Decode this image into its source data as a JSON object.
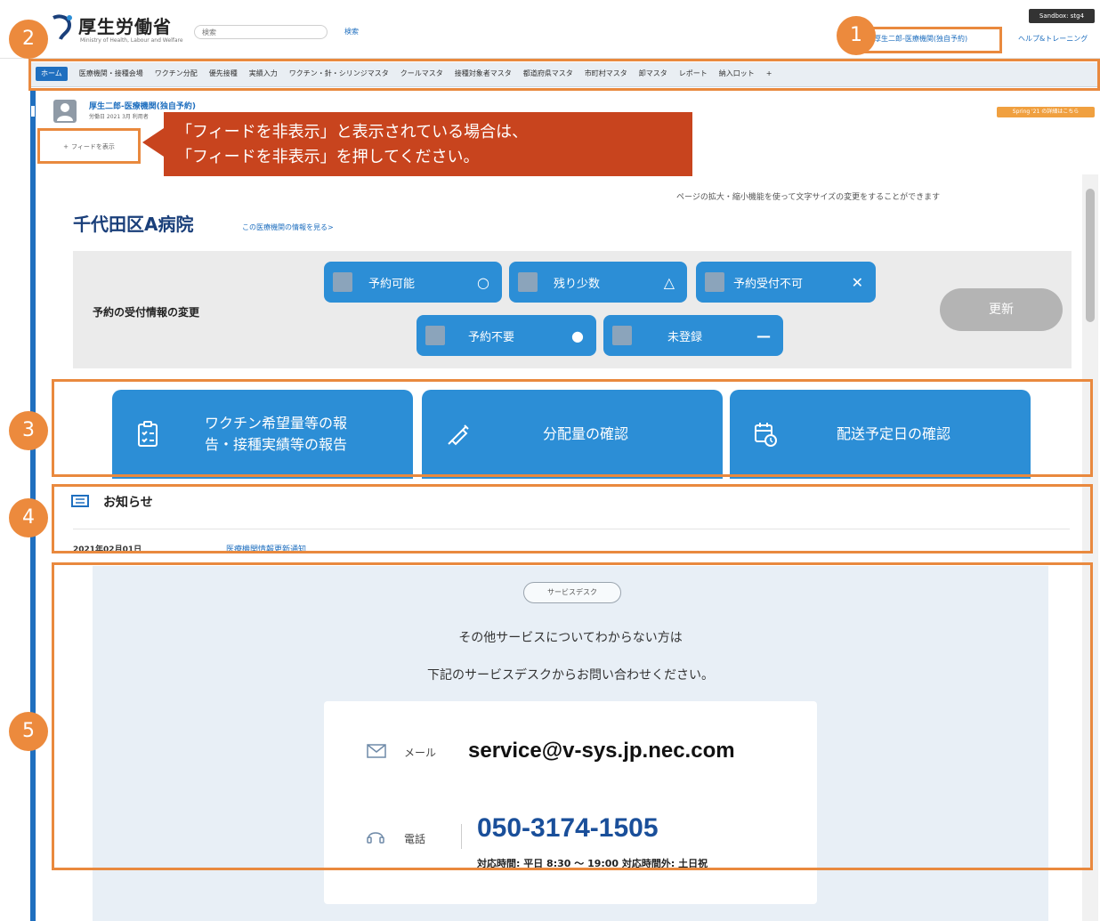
{
  "header": {
    "logo_title": "厚生労働省",
    "logo_sub": "Ministry of Health, Labour and Welfare",
    "search_placeholder": "検索",
    "search_button": "検索",
    "user_link": "厚生二郎-医療機関(独自予約)",
    "help_link": "ヘルプ&トレーニング",
    "sandbox_badge": "Sandbox: stg4"
  },
  "nav": {
    "items": [
      {
        "label": "ホーム",
        "active": true
      },
      {
        "label": "医療機関・接種会場"
      },
      {
        "label": "ワクチン分配"
      },
      {
        "label": "優先接種"
      },
      {
        "label": "実績入力"
      },
      {
        "label": "ワクチン・針・シリンジマスタ"
      },
      {
        "label": "クールマスタ"
      },
      {
        "label": "接種対象者マスタ"
      },
      {
        "label": "都道府県マスタ"
      },
      {
        "label": "市町村マスタ"
      },
      {
        "label": "卸マスタ"
      },
      {
        "label": "レポート"
      },
      {
        "label": "納入口ット"
      },
      {
        "label": "+"
      }
    ]
  },
  "record": {
    "title": "厚生二郎-医療機関(独自予約)",
    "subtitle": "労働日 2021 3月 利用者",
    "orange_pill": "Spring '21 の詳細はこちら",
    "feed_button": "フィードを表示"
  },
  "callout": {
    "line1": "「フィードを非表示」と表示されている場合は、",
    "line2": "「フィードを非表示」を押してください。"
  },
  "main": {
    "zoom_note": "ページの拡大・縮小機能を使って文字サイズの変更をすることができます",
    "hospital_name": "千代田区A病院",
    "hospital_link": "この医療機関の情報を見る>",
    "status_label": "予約の受付情報の変更",
    "status_buttons": [
      {
        "label": "予約可能",
        "symbol": "○"
      },
      {
        "label": "残り少数",
        "symbol": "△"
      },
      {
        "label": "予約受付不可",
        "symbol": "✕"
      },
      {
        "label": "予約不要",
        "symbol": "●"
      },
      {
        "label": "未登録",
        "symbol": "—"
      }
    ],
    "update_button": "更新",
    "actions": [
      {
        "line1": "ワクチン希望量等の報",
        "line2": "告・接種実績等の報告",
        "icon": "clipboard-check-icon"
      },
      {
        "line1": "分配量の確認",
        "line2": "",
        "icon": "syringe-icon"
      },
      {
        "line1": "配送予定日の確認",
        "line2": "",
        "icon": "calendar-clock-icon"
      }
    ]
  },
  "notice": {
    "title": "お知らせ",
    "date": "2021年02月01日",
    "text": "医療機関情報更新通知"
  },
  "service": {
    "tag": "サービスデスク",
    "line1": "その他サービスについてわからない方は",
    "line2": "下記のサービスデスクからお問い合わせください。",
    "mail_label": "メール",
    "mail_value": "service@v-sys.jp.nec.com",
    "phone_label": "電話",
    "phone_value": "050-3174-1505",
    "hours": "対応時間: 平日 8:30 ～ 19:00 対応時間外: 土日祝"
  },
  "annotations": {
    "n1": "1",
    "n2": "2",
    "n3": "3",
    "n4": "4",
    "n5": "5"
  },
  "colors": {
    "primary": "#2c8ed6",
    "callout": "#c8441e",
    "annotation": "#ec8a3d"
  }
}
